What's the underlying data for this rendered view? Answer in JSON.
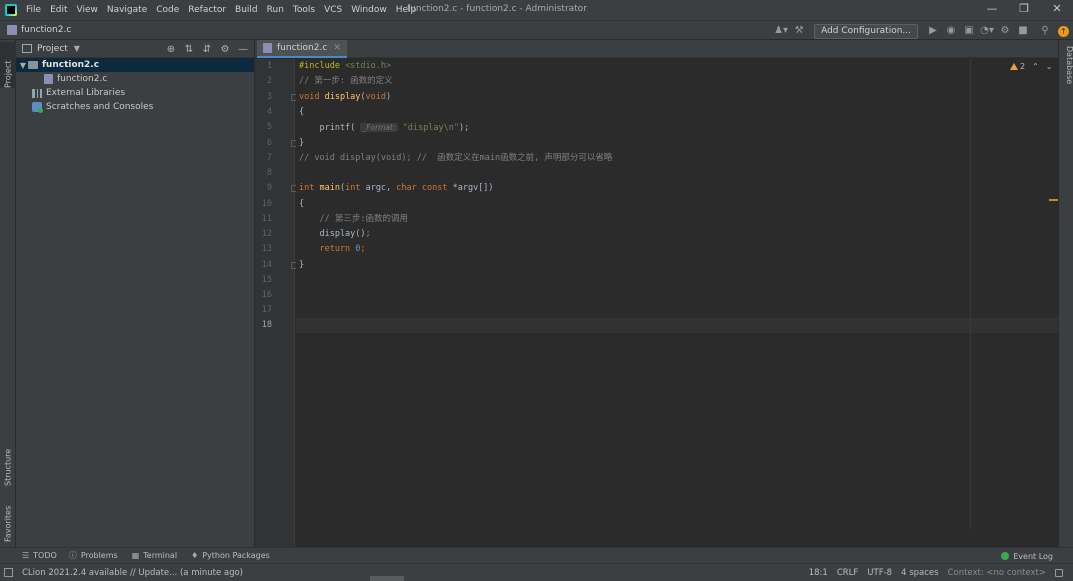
{
  "menubar": {
    "items": [
      "File",
      "Edit",
      "View",
      "Navigate",
      "Code",
      "Refactor",
      "Build",
      "Run",
      "Tools",
      "VCS",
      "Window",
      "Help"
    ],
    "window_title": "function2.c - function2.c - Administrator"
  },
  "navbar": {
    "breadcrumb": "function2.c",
    "add_configuration": "Add Configuration..."
  },
  "left_tabs": {
    "project": "Project",
    "structure": "Structure",
    "favorites": "Favorites"
  },
  "right_tabs": {
    "database": "Database"
  },
  "project_panel": {
    "title": "Project",
    "tree": [
      {
        "label": "function2.c",
        "type": "folder",
        "level": 0,
        "expanded": true,
        "selected": true
      },
      {
        "label": "function2.c",
        "type": "file",
        "level": 1
      },
      {
        "label": "External Libraries",
        "type": "library",
        "level": 0
      },
      {
        "label": "Scratches and Consoles",
        "type": "scratch",
        "level": 0
      }
    ]
  },
  "editor": {
    "tab": "function2.c",
    "current_line": 18,
    "line_numbers": [
      "1",
      "2",
      "3",
      "4",
      "5",
      "6",
      "7",
      "8",
      "9",
      "10",
      "11",
      "12",
      "13",
      "14",
      "15",
      "16",
      "17",
      "18"
    ],
    "code": {
      "l1_directive": "#include ",
      "l1_header": "<stdio.h>",
      "l2": "// 第一步: 函数的定义",
      "l3_kw": "void ",
      "l3_fn": "display",
      "l3_open": "(",
      "l3_param": "void",
      "l3_close": ")",
      "l4": "{",
      "l5_call": "    printf( ",
      "l5_hint": "_Format:",
      "l5_str": " \"display\\n\"",
      "l5_end": ");",
      "l6": "}",
      "l7": "// void display(void); //  函数定义在main函数之前, 声明部分可以省略",
      "l9_kw": "int ",
      "l9_fn": "main",
      "l9_open": "(",
      "l9_kw2": "int ",
      "l9_argc": "argc, ",
      "l9_kw3": "char const ",
      "l9_rest": "*argv[])",
      "l10": "{",
      "l11": "    // 第三步:函数的调用",
      "l12_call": "    display()",
      "l12_semi": ";",
      "l13_kw": "    return ",
      "l13_num": "0",
      "l13_semi": ";",
      "l14": "}"
    },
    "inspection_count": "2"
  },
  "tool_windows": {
    "todo": "TODO",
    "problems": "Problems",
    "terminal": "Terminal",
    "python_packages": "Python Packages",
    "event_log": "Event Log"
  },
  "statusbar": {
    "message": "CLion 2021.2.4 available // Update... (a minute ago)",
    "position": "18:1",
    "line_sep": "CRLF",
    "encoding": "UTF-8",
    "indent": "4 spaces",
    "context": "Context: <no context>"
  }
}
